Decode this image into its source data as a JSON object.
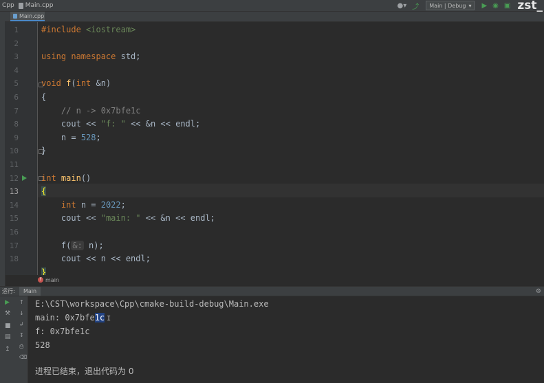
{
  "topbar": {
    "project": "Cpp",
    "file": "Main.cpp",
    "run_config": "Main | Debug",
    "watermark": "zst_"
  },
  "tabs": [
    {
      "label": "Main.cpp"
    }
  ],
  "code_lines": [
    {
      "num": "1"
    },
    {
      "num": "2"
    },
    {
      "num": "3"
    },
    {
      "num": "4"
    },
    {
      "num": "5"
    },
    {
      "num": "6"
    },
    {
      "num": "7"
    },
    {
      "num": "8"
    },
    {
      "num": "9"
    },
    {
      "num": "10"
    },
    {
      "num": "11"
    },
    {
      "num": "12"
    },
    {
      "num": "13"
    },
    {
      "num": "14"
    },
    {
      "num": "15"
    },
    {
      "num": "16"
    },
    {
      "num": "17"
    },
    {
      "num": "18"
    }
  ],
  "code": {
    "include": "#include",
    "iostream": "<iostream>",
    "using_ns": "using namespace",
    "std": " std;",
    "void": "void",
    "f_name": "f",
    "f_params_open": "(",
    "int": "int",
    "f_param": " &n)",
    "brace_open": "{",
    "brace_close": "}",
    "comment": "// n -> 0x7bfe1c",
    "cout": "cout",
    "op": " << ",
    "str_f": "\"f: \"",
    "amp_n_endl": " << &n << endl;",
    "n_assign": "n = ",
    "val_528": "528",
    "semicolon": ";",
    "main_name": "main",
    "main_parens": "()",
    "decl_n": " n = ",
    "val_2022": "2022",
    "str_main": "\"main: \"",
    "call_f": "f(",
    "param_hint": "&:",
    "call_f_end": " n);",
    "n_endl": " << n << endl;"
  },
  "breadcrumb": {
    "label": "main",
    "badge": "f"
  },
  "run_panel": {
    "label": "运行:",
    "tab": "Main"
  },
  "console": {
    "path": "E:\\CST\\workspace\\Cpp\\cmake-build-debug\\Main.exe",
    "main_prefix": "main: 0x7bfe",
    "main_selected": "1c",
    "f_line": "f: 0x7bfe1c",
    "val_line": "528",
    "exit_line": "进程已结束，退出代码为 0"
  },
  "colors": {
    "keyword": "#cc7832",
    "function": "#ffc66d",
    "string": "#6a8759",
    "number": "#6897bb",
    "comment": "#808080",
    "selection": "#214283"
  }
}
